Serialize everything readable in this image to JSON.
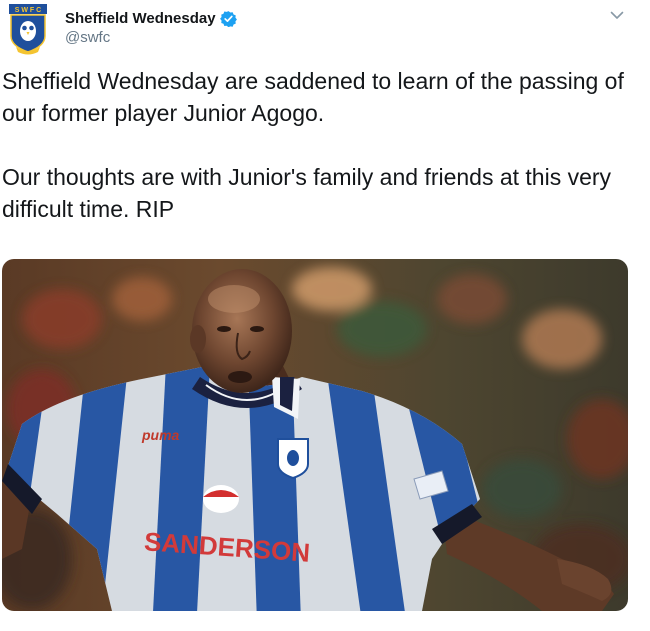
{
  "tweet": {
    "author": {
      "display_name": "Sheffield Wednesday",
      "handle": "@swfc",
      "verified": true,
      "avatar_icon": "owl-crest-icon",
      "avatar_text": "S W F C"
    },
    "menu_icon": "chevron-down-icon",
    "text_paragraphs": [
      "Sheffield Wednesday are saddened to learn of the passing of our former player Junior Agogo.",
      "Our thoughts are with Junior's family and friends at this very difficult time. RIP"
    ],
    "media": {
      "shirt_sponsor": "SANDERSON"
    }
  },
  "colors": {
    "verified": "#1da1f2",
    "text": "#14171a",
    "secondary_text": "#657786",
    "stripe_blue": "#2d5fb2",
    "stripe_white": "#f3f5f8"
  }
}
